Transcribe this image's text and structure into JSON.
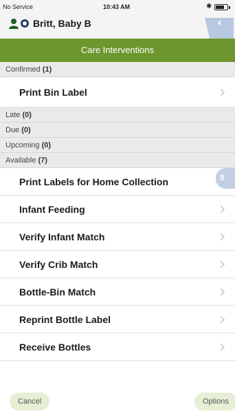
{
  "status_bar": {
    "carrier": "No Service",
    "time": "10:43 AM"
  },
  "patient": {
    "name": "Britt, Baby B"
  },
  "title": "Care Interventions",
  "sections": {
    "confirmed": {
      "label": "Confirmed",
      "count": "(1)"
    },
    "late": {
      "label": "Late",
      "count": "(0)"
    },
    "due": {
      "label": "Due",
      "count": "(0)"
    },
    "upcoming": {
      "label": "Upcoming",
      "count": "(0)"
    },
    "available": {
      "label": "Available",
      "count": "(7)"
    }
  },
  "confirmed_items": [
    "Print Bin Label"
  ],
  "available_items": [
    "Print Labels for Home Collection",
    "Infant Feeding",
    "Verify Infant Match",
    "Verify Crib Match",
    "Bottle-Bin Match",
    "Reprint Bottle Label",
    "Receive Bottles"
  ],
  "footer": {
    "cancel": "Cancel",
    "options": "Options"
  },
  "colors": {
    "title_bar": "#6e962e",
    "section_bg": "#eaeaea",
    "pill_bg": "#e6eed6"
  }
}
